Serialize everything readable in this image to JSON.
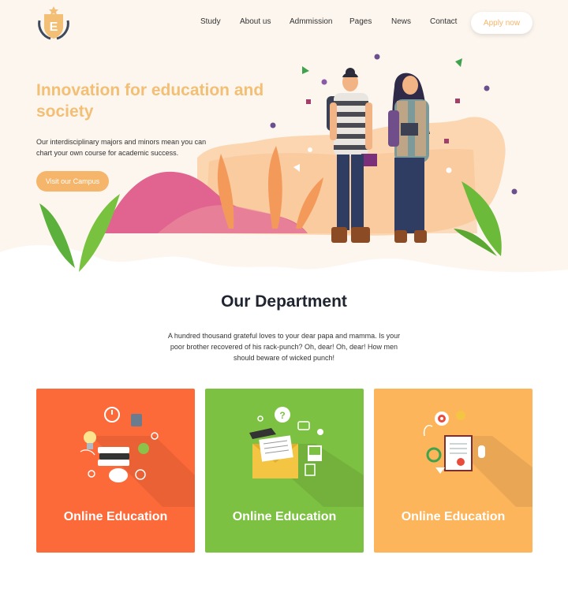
{
  "brand": {
    "logo_letter": "E"
  },
  "nav": {
    "items": [
      "Study",
      "About us",
      "Admmission",
      "Pages",
      "News",
      "Contact"
    ],
    "apply_label": "Apply now"
  },
  "hero": {
    "title": "Innovation for education and society",
    "text": "Our interdisciplinary majors and minors mean you can chart your own course for academic success.",
    "button_label": "Visit our Campus"
  },
  "department": {
    "title": "Our Department",
    "text": "A hundred thousand grateful loves to your dear papa and mamma. Is your poor brother recovered of his rack-punch? Oh, dear! Oh, dear! How men should beware of wicked punch!"
  },
  "cards": [
    {
      "label": "Online Education",
      "color": "#fd6a3a"
    },
    {
      "label": "Online Education",
      "color": "#7dc142"
    },
    {
      "label": "Online Education",
      "color": "#fdb55c"
    }
  ],
  "colors": {
    "accent": "#f5b66b",
    "hero_bg": "#fdf6ee"
  }
}
